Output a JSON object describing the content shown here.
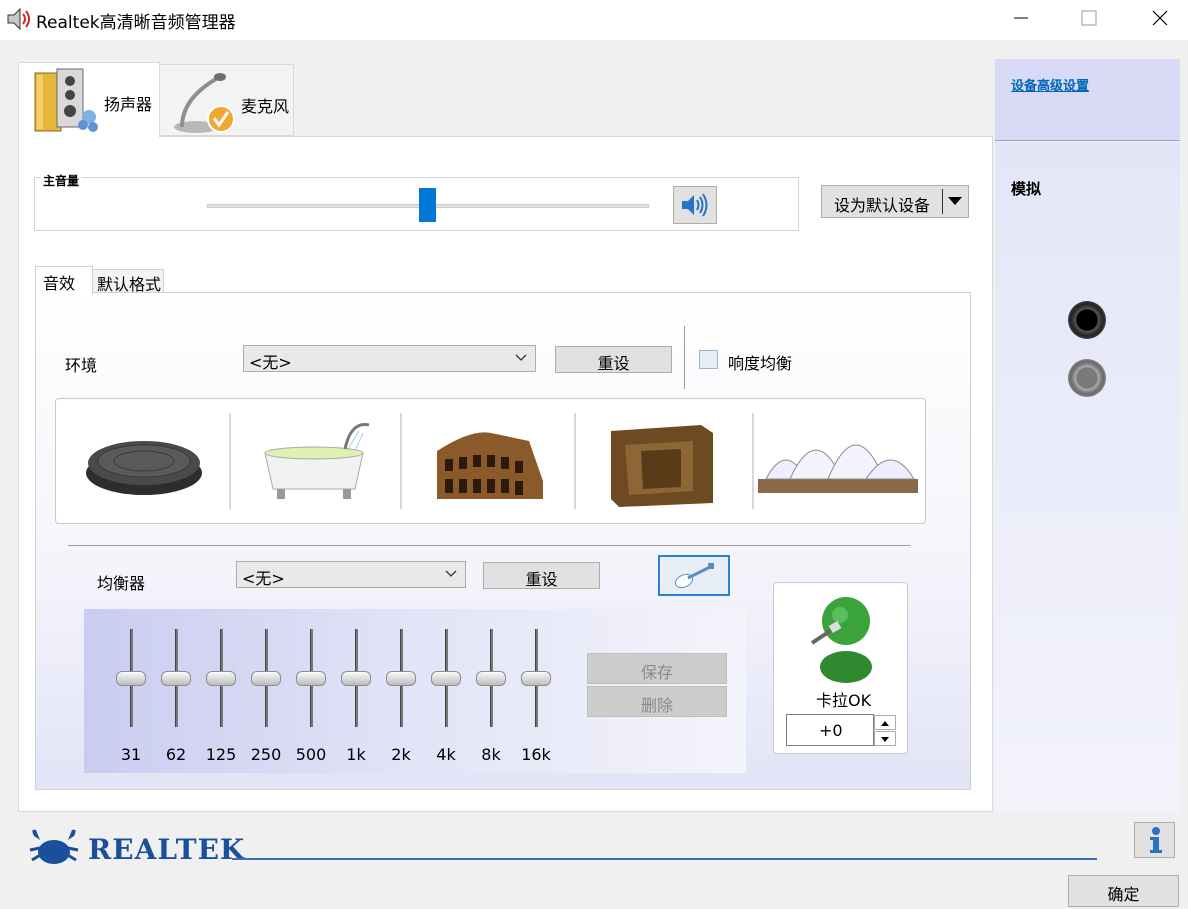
{
  "window": {
    "title": "Realtek高清晰音频管理器",
    "icon": "speaker-volume-icon"
  },
  "device_tabs": [
    {
      "label": "扬声器",
      "icon": "speakers-icon",
      "active": true
    },
    {
      "label": "麦克风",
      "icon": "microphone-icon",
      "active": false
    }
  ],
  "master_volume": {
    "label": "主音量",
    "level_percent": 50,
    "mute_icon": "speaker-volume-icon"
  },
  "default_device_button": "设为默认设备",
  "inner_tabs": [
    {
      "label": "音效",
      "active": true
    },
    {
      "label": "默认格式",
      "active": false
    }
  ],
  "environment": {
    "label": "环境",
    "selected": "<无>",
    "reset_label": "重设",
    "loudness_label": "响度均衡",
    "loudness_checked": false,
    "presets": [
      {
        "icon": "manhole-cover-icon"
      },
      {
        "icon": "bathtub-icon"
      },
      {
        "icon": "colosseum-icon"
      },
      {
        "icon": "stone-room-icon"
      },
      {
        "icon": "opera-house-icon"
      }
    ]
  },
  "equalizer": {
    "label": "均衡器",
    "selected": "<无>",
    "reset_label": "重设",
    "guitar_icon": "guitar-icon",
    "bands": [
      "31",
      "62",
      "125",
      "250",
      "500",
      "1k",
      "2k",
      "4k",
      "8k",
      "16k"
    ],
    "band_levels": [
      0,
      0,
      0,
      0,
      0,
      0,
      0,
      0,
      0,
      0
    ],
    "save_label": "保存",
    "delete_label": "删除"
  },
  "karaoke": {
    "label": "卡拉OK",
    "value": "+0",
    "icon": "karaoke-singer-icon"
  },
  "right_panel": {
    "advanced_link": "设备高级设置",
    "analog_label": "模拟",
    "jacks": [
      {
        "icon": "audio-jack-black-icon",
        "color": "#111111"
      },
      {
        "icon": "audio-jack-gray-icon",
        "color": "#8a8a8a"
      }
    ]
  },
  "footer": {
    "brand": "REALTEK",
    "logo_icon": "realtek-crab-icon",
    "info_icon": "info-icon",
    "ok_label": "确定"
  }
}
